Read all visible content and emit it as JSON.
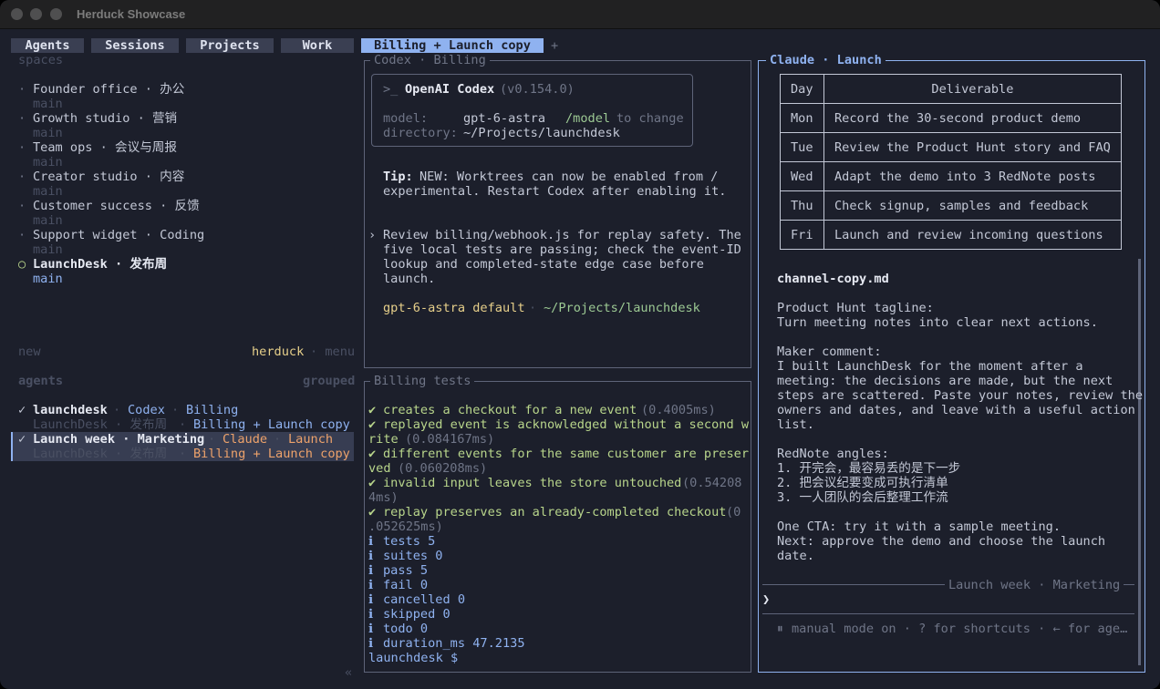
{
  "window": {
    "title": "Herduck Showcase"
  },
  "tabs": [
    {
      "label": "Agents"
    },
    {
      "label": "Sessions"
    },
    {
      "label": "Projects"
    },
    {
      "label": "Work"
    },
    {
      "label": "Billing + Launch copy"
    }
  ],
  "new_tab_icon": "+",
  "sidebar": {
    "spaces_label": "spaces",
    "spaces": [
      {
        "name": "Founder office · 办公",
        "branch": "main"
      },
      {
        "name": "Growth studio · 营销",
        "branch": "main"
      },
      {
        "name": "Team ops · 会议与周报",
        "branch": "main"
      },
      {
        "name": "Creator studio · 内容",
        "branch": "main"
      },
      {
        "name": "Customer success · 反馈",
        "branch": "main"
      },
      {
        "name": "Support widget · Coding",
        "branch": "main"
      },
      {
        "name": "LaunchDesk · 发布周",
        "branch": "main",
        "active": true
      }
    ],
    "bullet": "·",
    "active_bullet": "○",
    "new_label": "new",
    "brand": "herduck",
    "menu_label": "· menu",
    "agents_label": "agents",
    "grouped_label": "grouped",
    "agents": [
      {
        "check": "✓",
        "name": "launchdesk",
        "sep": "·",
        "tool": "Codex",
        "task": "Billing",
        "sub_space": "LaunchDesk · 发布周",
        "sub_tab": "Billing + Launch copy"
      },
      {
        "check": "✓",
        "name": "Launch week · Marketing",
        "sep": "·",
        "tool": "Claude",
        "task": "Launch",
        "sub_space": "LaunchDesk · 发布周",
        "sub_tab": "Billing + Launch copy"
      }
    ],
    "collapse_icon": "«"
  },
  "codex": {
    "pane_title": "Codex · Billing",
    "prompt_icon": ">_",
    "app_name": "OpenAI Codex",
    "version": "(v0.154.0)",
    "model_label": "model:",
    "model_value": "gpt-6-astra",
    "model_hint_cmd": "/model",
    "model_hint_rest": "to change",
    "dir_label": "directory:",
    "dir_value": "~/Projects/launchdesk",
    "tip_label": "Tip:",
    "tip_line1": "NEW: Worktrees can now be enabled from /",
    "tip_line2": "experimental. Restart Codex after enabling it.",
    "msg_marker": "›",
    "msg_lines": [
      "Review billing/webhook.js for replay safety. The",
      "five local tests are passing; check the event-ID",
      "lookup and completed-state edge case before",
      "launch."
    ],
    "status_model": "gpt-6-astra default",
    "status_sep": "·",
    "status_dir": "~/Projects/launchdesk"
  },
  "tests": {
    "pane_title": "Billing tests",
    "lines": [
      {
        "icon": "✔",
        "text": "creates a checkout for a new event",
        "time": "(0.4005ms)"
      },
      {
        "icon": "✔",
        "text": "replayed event is acknowledged without a second w",
        "cont_text": "rite",
        "time": "(0.084167ms)"
      },
      {
        "icon": "✔",
        "text": "different events for the same customer are preser",
        "cont_text": "ved",
        "time": "(0.060208ms)"
      },
      {
        "icon": "✔",
        "text": "invalid input leaves the store untouched",
        "time": "(0.54208",
        "cont_time": "4ms)"
      },
      {
        "icon": "✔",
        "text": "replay preserves an already-completed checkout",
        "time": "(0",
        "cont_time": ".052625ms)"
      }
    ],
    "summary": [
      {
        "icon": "ℹ",
        "text": "tests 5"
      },
      {
        "icon": "ℹ",
        "text": "suites 0"
      },
      {
        "icon": "ℹ",
        "text": "pass 5"
      },
      {
        "icon": "ℹ",
        "text": "fail 0"
      },
      {
        "icon": "ℹ",
        "text": "cancelled 0"
      },
      {
        "icon": "ℹ",
        "text": "skipped 0"
      },
      {
        "icon": "ℹ",
        "text": "todo 0"
      },
      {
        "icon": "ℹ",
        "text": "duration_ms 47.2135"
      }
    ],
    "prompt": "launchdesk $"
  },
  "claude": {
    "pane_title": "Claude · Launch",
    "table_header": [
      "Day",
      "Deliverable"
    ],
    "table_rows": [
      [
        "Mon",
        "Record the 30-second product demo"
      ],
      [
        "Tue",
        "Review the Product Hunt story and FAQ"
      ],
      [
        "Wed",
        "Adapt the demo into 3 RedNote posts"
      ],
      [
        "Thu",
        "Check signup, samples and feedback"
      ],
      [
        "Fri",
        "Launch and review incoming questions"
      ]
    ],
    "file_name": "channel-copy.md",
    "lines": [
      "Product Hunt tagline:",
      "Turn meeting notes into clear next actions.",
      "",
      "Maker comment:",
      "I built LaunchDesk for the moment after a",
      "meeting: the decisions are made, but the next",
      "steps are scattered. Paste your notes, review the",
      "owners and dates, and leave with a useful action",
      "list.",
      "",
      "RedNote angles:",
      "1. 开完会，最容易丢的是下一步",
      "2. 把会议纪要变成可执行清单",
      "3. 一人团队的会后整理工作流",
      "",
      "One CTA: try it with a sample meeting.",
      "Next: approve the demo and choose the launch",
      "date."
    ],
    "divider_label": "Launch week · Marketing",
    "input_prompt": "❯",
    "footer_icon": "⏸",
    "footer": "manual mode on · ? for shortcuts · ← for age…"
  },
  "colors": {
    "accent": "#8fb2f0",
    "background": "#1c1f2b",
    "pass": "#b8d58b",
    "warning": "#eda26b"
  }
}
